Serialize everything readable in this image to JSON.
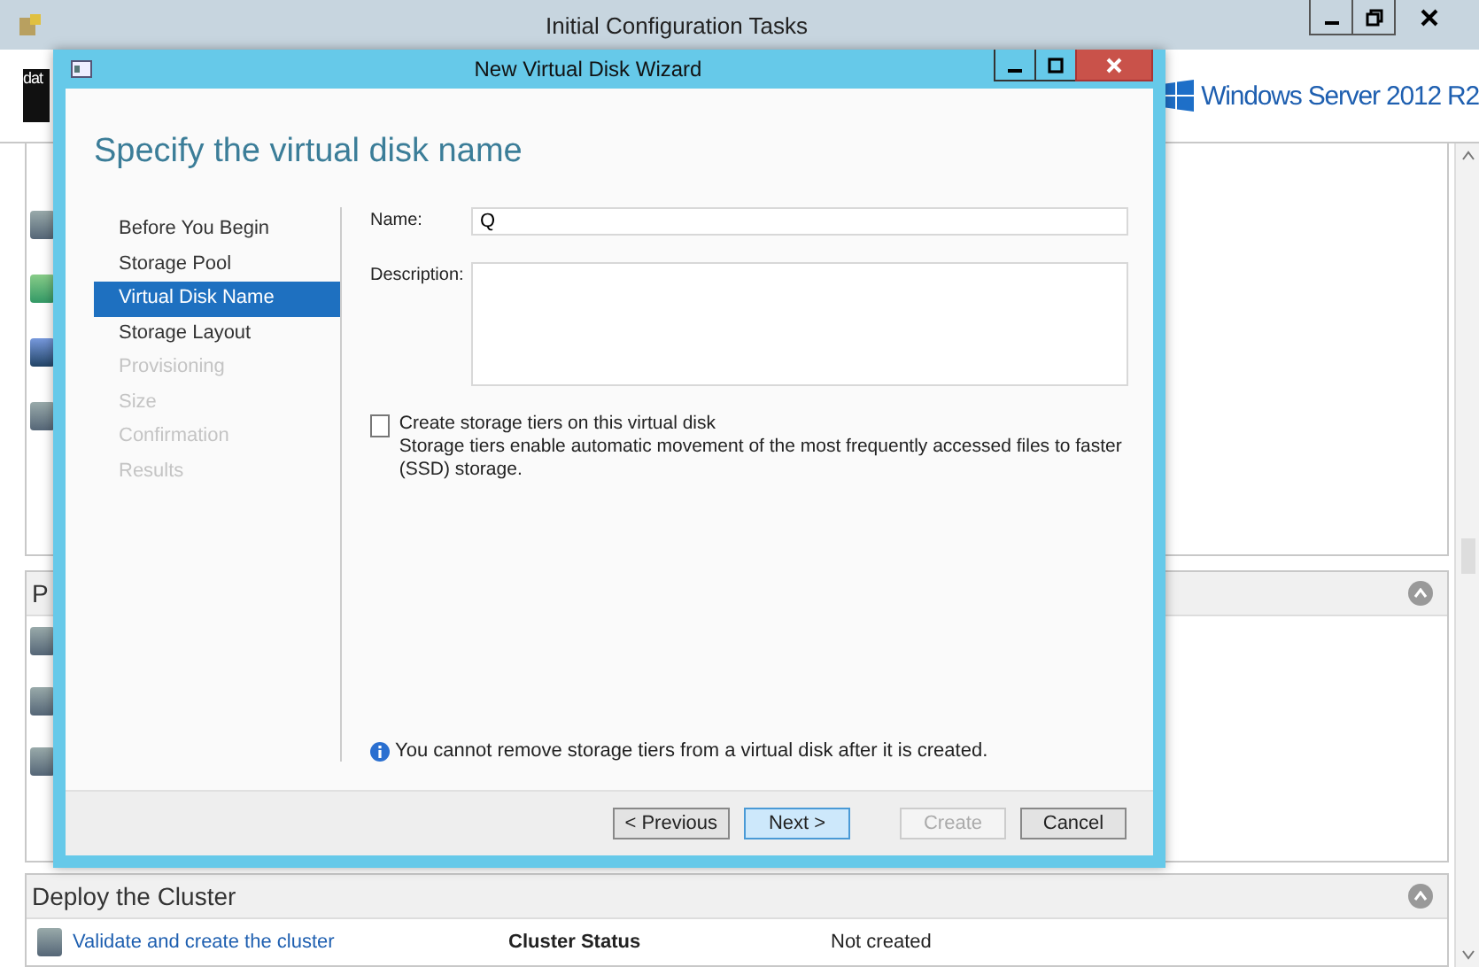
{
  "window": {
    "title": "Initial Configuration Tasks"
  },
  "header": {
    "logo_text": "dat",
    "product": "Windows Server 2012 R2"
  },
  "sections": [
    {
      "title": "P"
    },
    {
      "title": "Deploy the Cluster",
      "task": {
        "link": "Validate and create the cluster",
        "label": "Cluster Status",
        "value": "Not created"
      }
    }
  ],
  "dialog": {
    "title": "New Virtual Disk Wizard",
    "heading": "Specify the virtual disk name",
    "steps": [
      {
        "label": "Before You Begin",
        "selected": false,
        "disabled": false
      },
      {
        "label": "Storage Pool",
        "selected": false,
        "disabled": false
      },
      {
        "label": "Virtual Disk Name",
        "selected": true,
        "disabled": false
      },
      {
        "label": "Storage Layout",
        "selected": false,
        "disabled": false
      },
      {
        "label": "Provisioning",
        "selected": false,
        "disabled": true
      },
      {
        "label": "Size",
        "selected": false,
        "disabled": true
      },
      {
        "label": "Confirmation",
        "selected": false,
        "disabled": true
      },
      {
        "label": "Results",
        "selected": false,
        "disabled": true
      }
    ],
    "name": {
      "label": "Name:",
      "value": "Q"
    },
    "description": {
      "label": "Description:"
    },
    "tiers": {
      "label": "Create storage tiers on this virtual disk",
      "checked": false,
      "help": "Storage tiers enable automatic movement of the most frequently accessed files to faster (SSD) storage."
    },
    "info": "You cannot remove storage tiers from a virtual disk after it is created.",
    "buttons": [
      {
        "label": "< Previous",
        "disabled": false,
        "highlighted": false
      },
      {
        "label": "Next >",
        "disabled": false,
        "highlighted": true
      },
      {
        "label": "Create",
        "disabled": true,
        "highlighted": false
      },
      {
        "label": "Cancel",
        "disabled": false,
        "highlighted": false
      }
    ]
  }
}
